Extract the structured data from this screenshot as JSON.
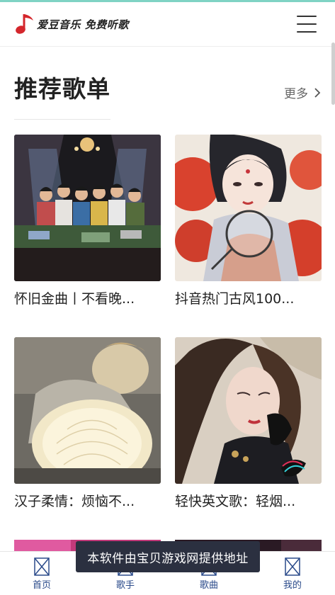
{
  "header": {
    "logo_text": "爱豆音乐 免费听歌",
    "menu_icon": "hamburger-menu-icon"
  },
  "section": {
    "title": "推荐歌单",
    "more_label": "更多"
  },
  "playlists": [
    {
      "title": "怀旧金曲丨不看晚..."
    },
    {
      "title": "抖音热门古风100..."
    },
    {
      "title": "汉子柔情：烦恼不..."
    },
    {
      "title": "轻快英文歌：轻烟..."
    }
  ],
  "toast": {
    "text": "本软件由宝贝游戏网提供地址"
  },
  "bottom_nav": [
    {
      "label": "首页"
    },
    {
      "label": "歌手"
    },
    {
      "label": "歌曲"
    },
    {
      "label": "我的"
    }
  ],
  "colors": {
    "accent": "#7fd3c4",
    "logo_red": "#d4262c",
    "nav_label": "#2a4a8a",
    "toast_bg": "#2b3040"
  }
}
